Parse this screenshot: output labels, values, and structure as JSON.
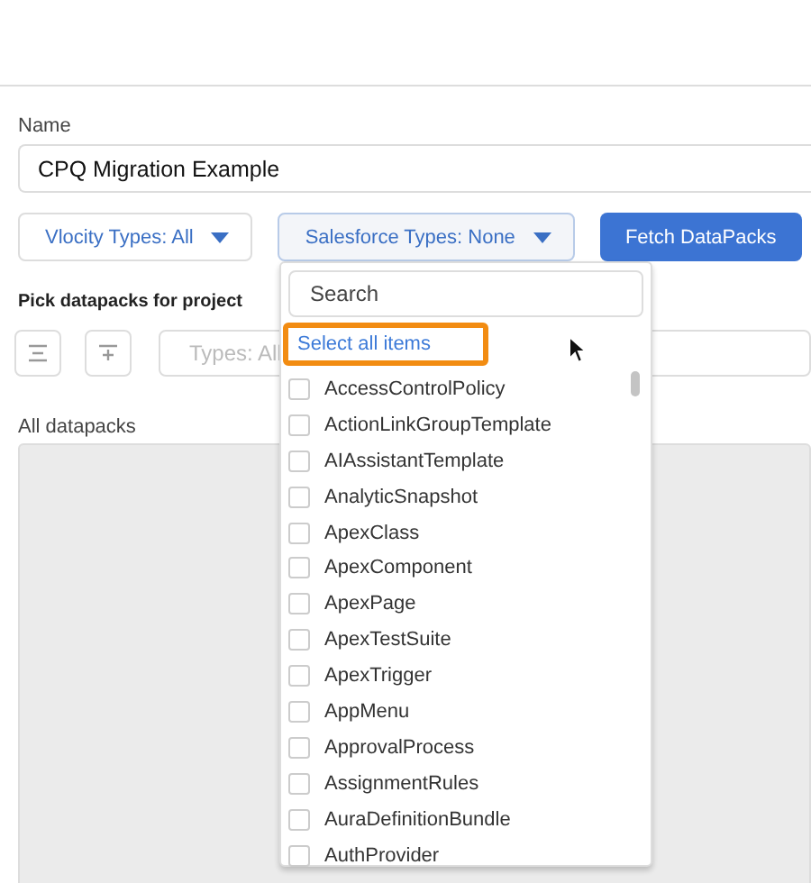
{
  "name_field": {
    "label": "Name",
    "value": "CPQ Migration Example"
  },
  "filters": [
    {
      "label": "Vlocity Types: All",
      "open": false
    },
    {
      "label": "Salesforce Types: None",
      "open": true
    }
  ],
  "fetch_button": "Fetch DataPacks",
  "pick_label": "Pick datapacks for project",
  "types_field": {
    "placeholder": "Types: All"
  },
  "all_label": "All datapacks",
  "dropdown": {
    "search": {
      "placeholder": "Search"
    },
    "select_all": "Select all items",
    "items": [
      {
        "label": "AccessControlPolicy",
        "checked": false
      },
      {
        "label": "ActionLinkGroupTemplate",
        "checked": false
      },
      {
        "label": "AIAssistantTemplate",
        "checked": false
      },
      {
        "label": "AnalyticSnapshot",
        "checked": false
      },
      {
        "label": "ApexClass",
        "checked": false
      },
      {
        "label": "ApexComponent",
        "checked": false
      },
      {
        "label": "ApexPage",
        "checked": false
      },
      {
        "label": "ApexTestSuite",
        "checked": false
      },
      {
        "label": "ApexTrigger",
        "checked": false
      },
      {
        "label": "AppMenu",
        "checked": false
      },
      {
        "label": "ApprovalProcess",
        "checked": false
      },
      {
        "label": "AssignmentRules",
        "checked": false
      },
      {
        "label": "AuraDefinitionBundle",
        "checked": false
      },
      {
        "label": "AuthProvider",
        "checked": false
      }
    ]
  }
}
